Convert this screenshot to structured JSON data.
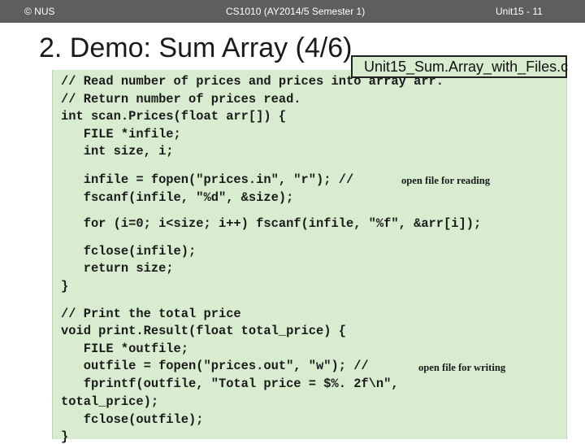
{
  "header": {
    "left": "© NUS",
    "center": "CS1010 (AY2014/5 Semester 1)",
    "right": "Unit15 - 11"
  },
  "slide": {
    "title": "2. Demo: Sum Array (4/6)",
    "file_tag": "Unit15_Sum.Array_with_Files.c"
  },
  "code": {
    "lines": [
      "// Read number of prices and prices into array arr.",
      "// Return number of prices read.",
      "int scan.Prices(float arr[]) {",
      "   FILE *infile;",
      "   int size, i;",
      "   infile = fopen(\"prices.in\", \"r\"); //",
      "open file for reading",
      "   fscanf(infile, \"%d\", &size);",
      "   for (i=0; i<size; i++) fscanf(infile, \"%f\", &arr[i]);",
      "   fclose(infile);",
      "   return size;",
      "}",
      "// Print the total price",
      "void print.Result(float total_price) {",
      "   FILE *outfile;",
      "   outfile = fopen(\"prices.out\", \"w\"); //",
      "open file for writing",
      "   fprintf(outfile, \"Total price = $%. 2f\\n\",",
      "total_price);",
      "   fclose(outfile);",
      "}"
    ]
  }
}
